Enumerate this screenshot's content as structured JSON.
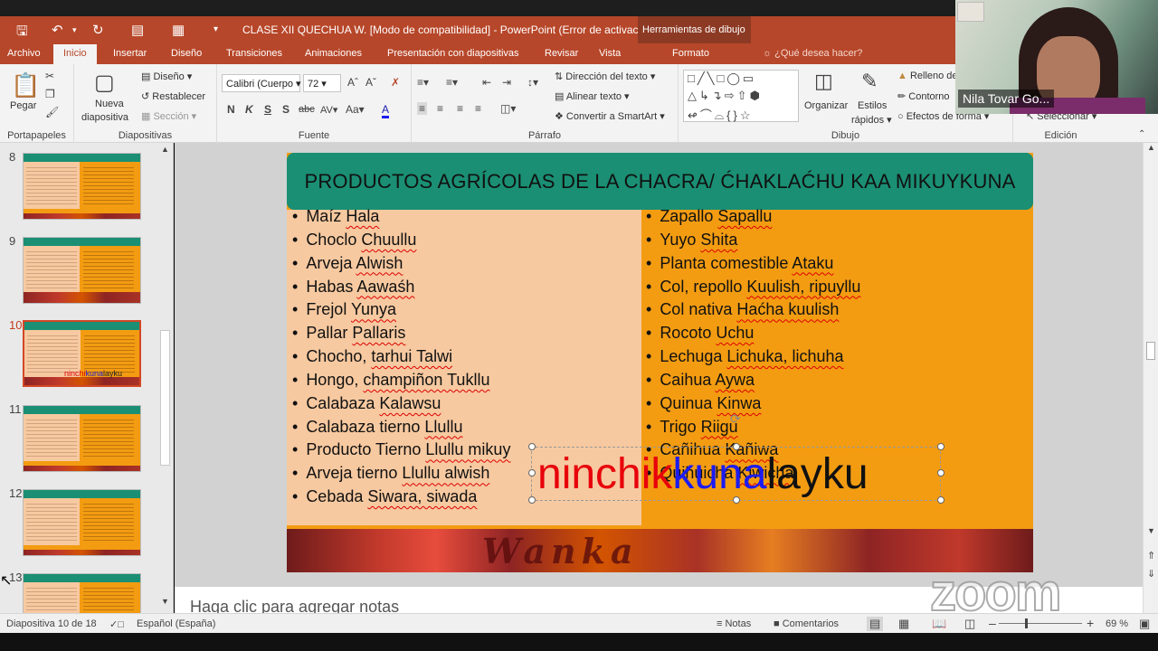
{
  "titlebar": {
    "title": "CLASE XII QUECHUA W. [Modo de compatibilidad] - PowerPoint (Error de activació...",
    "contextual_tab": "Herramientas de dibujo"
  },
  "tabs": [
    {
      "label": "Archivo"
    },
    {
      "label": "Inicio"
    },
    {
      "label": "Insertar"
    },
    {
      "label": "Diseño"
    },
    {
      "label": "Transiciones"
    },
    {
      "label": "Animaciones"
    },
    {
      "label": "Presentación con diapositivas"
    },
    {
      "label": "Revisar"
    },
    {
      "label": "Vista"
    },
    {
      "label": "Formato"
    }
  ],
  "tell_me": "¿Qué desea hacer?",
  "ribbon": {
    "portapapeles": {
      "label": "Portapapeles",
      "paste": "Pegar"
    },
    "diapositivas": {
      "label": "Diapositivas",
      "new_slide": "Nueva",
      "new_slide2": "diapositiva",
      "layout": "Diseño",
      "reset": "Restablecer",
      "section": "Sección"
    },
    "fuente": {
      "label": "Fuente",
      "font_name": "Calibri (Cuerpo",
      "font_size": "72"
    },
    "parrafo": {
      "label": "Párrafo",
      "text_direction": "Dirección del texto",
      "align_text": "Alinear texto",
      "smartart": "Convertir a SmartArt"
    },
    "dibujo": {
      "label": "Dibujo",
      "arrange": "Organizar",
      "quick_styles": "Estilos",
      "quick_styles2": "rápidos",
      "fill": "Relleno de",
      "outline": "Contorno",
      "effects": "Efectos de forma"
    },
    "edicion": {
      "label": "Edición",
      "select": "Seleccionar"
    }
  },
  "thumbnails": [
    {
      "num": "8"
    },
    {
      "num": "9"
    },
    {
      "num": "10",
      "word": [
        "ninchi",
        "kuna",
        "layku"
      ]
    },
    {
      "num": "11"
    },
    {
      "num": "12"
    },
    {
      "num": "13"
    }
  ],
  "slide": {
    "title": "PRODUCTOS AGRÍCOLAS DE LA CHACRA/ ĆHAKLAĆHU KAA MIKUYKUNA",
    "left_items": [
      {
        "es": "Maíz",
        "qu": "Hala"
      },
      {
        "es": "Choclo",
        "qu": "Chuullu"
      },
      {
        "es": "Arveja",
        "qu": "Alwish"
      },
      {
        "es": "Habas",
        "qu": "Aawaśh"
      },
      {
        "es": "Frejol",
        "qu": "Yunya"
      },
      {
        "es": "Pallar",
        "qu": "Pallaris"
      },
      {
        "es": "Chocho,",
        "qu": "tarhui Talwi"
      },
      {
        "es": "Hongo,",
        "qu": "champiñon Tukllu"
      },
      {
        "es": "Calabaza",
        "qu": "Kalawsu"
      },
      {
        "es": "Calabaza tierno",
        "qu": "Llullu"
      },
      {
        "es": "Producto Tierno",
        "qu": "Llullu mikuy"
      },
      {
        "es": "Arveja tierno",
        "qu": "Llullu alwish"
      },
      {
        "es": "Cebada",
        "qu": "Siwara, siwada"
      }
    ],
    "right_items": [
      {
        "es": "Zapallo",
        "qu": "Sapallu"
      },
      {
        "es": "Yuyo",
        "qu": "Shita"
      },
      {
        "es": "Planta comestible",
        "qu": "Ataku"
      },
      {
        "es": "Col, repollo",
        "qu": "Kuulish, ripuyllu"
      },
      {
        "es": "Col nativa",
        "qu": "Haćha kuulish"
      },
      {
        "es": "Rocoto",
        "qu": "Uchu"
      },
      {
        "es": "Lechuga",
        "qu": "Lichuka, lichuha"
      },
      {
        "es": "Caihua",
        "qu": "Aywa"
      },
      {
        "es": "Quinua",
        "qu": "Kinwa"
      },
      {
        "es": "Trigo",
        "qu": "Riigu"
      },
      {
        "es": "Cañihua",
        "qu": "Kañiwa"
      },
      {
        "es": "Quihuicha",
        "qu": "Kiwicha"
      }
    ],
    "wordart": {
      "part1": "ninchik",
      "part2": "kuna",
      "part3": "layku"
    },
    "band_word": "Wanka",
    "colors": {
      "header": "#1a8f74",
      "left_col": "#f7c9a0",
      "right_col": "#f39c12",
      "word_red": "#e8000b",
      "word_blue": "#1c1cf0"
    }
  },
  "notes_placeholder": "Haga clic para agregar notas",
  "status": {
    "slide_info": "Diapositiva 10 de 18",
    "language": "Español (España)",
    "notes": "Notas",
    "comments": "Comentarios",
    "zoom": "69 %",
    "zoom_level": 69
  },
  "video": {
    "participant": "Nila Tovar Go..."
  },
  "zoom_logo": "zoom"
}
